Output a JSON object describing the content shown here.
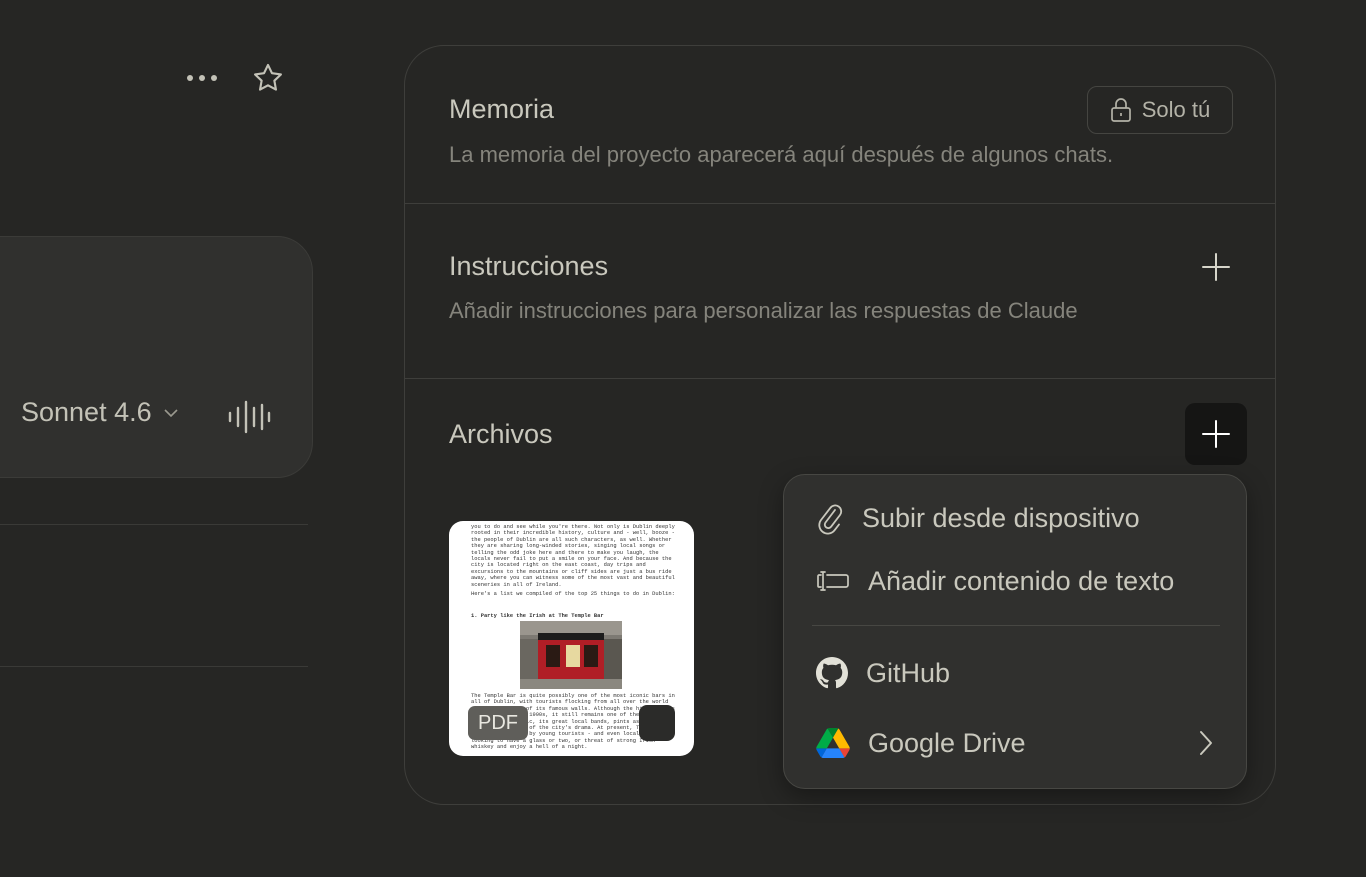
{
  "header": {
    "more_icon": "more-horizontal-icon",
    "star_icon": "star-icon"
  },
  "composer": {
    "model": "Sonnet 4.6",
    "voice_icon": "voice-waveform-icon"
  },
  "memory": {
    "title": "Memoria",
    "visibility_label": "Solo tú",
    "description": "La memoria del proyecto aparecerá aquí después de algunos chats."
  },
  "instructions": {
    "title": "Instrucciones",
    "description": "Añadir instrucciones para personalizar las respuestas de Claude"
  },
  "files": {
    "title": "Archivos",
    "items": [
      {
        "type_badge": "PDF",
        "preview_text_top": "you to do and see while you're there. Not only is Dublin deeply rooted in their incredible history, culture and - well, booze - the people of Dublin are all such characters, as well. Whether they are sharing long-winded stories, singing local songs or telling the odd joke here and there to make you laugh, the locals never fail to put a smile on your face. And because the city is located right on the east coast, day trips and excursions to the mountains or cliff sides are just a bus ride away, where you can witness some of the most vast and beautiful sceneries in all of Ireland.",
        "preview_text_list": "Here's a list we compiled of the top 25 things to do in Dublin:",
        "preview_heading": "1. Party like the Irish at The Temple Bar",
        "preview_text_bottom": "The Temple Bar is quite possibly one of the most iconic bars in all of Dublin, with tourists flocking from all over the world to get a glimpse of its famous walls. Although the history goes back to the early 1990s, it still remains one of the most famous and eclectic, its great local bands, pints as well as being a huge part of the city's drama. At present, The Temple Bar is frequented by young tourists - and even locals alike - looking to have a glass or two, or threat of strong Irish whiskey and enjoy a hell of a night."
      }
    ]
  },
  "upload_menu": {
    "items": [
      {
        "label": "Subir desde dispositivo",
        "icon": "paperclip-icon"
      },
      {
        "label": "Añadir contenido de texto",
        "icon": "text-content-icon"
      },
      {
        "label": "GitHub",
        "icon": "github-icon"
      },
      {
        "label": "Google Drive",
        "icon": "google-drive-icon"
      }
    ]
  }
}
